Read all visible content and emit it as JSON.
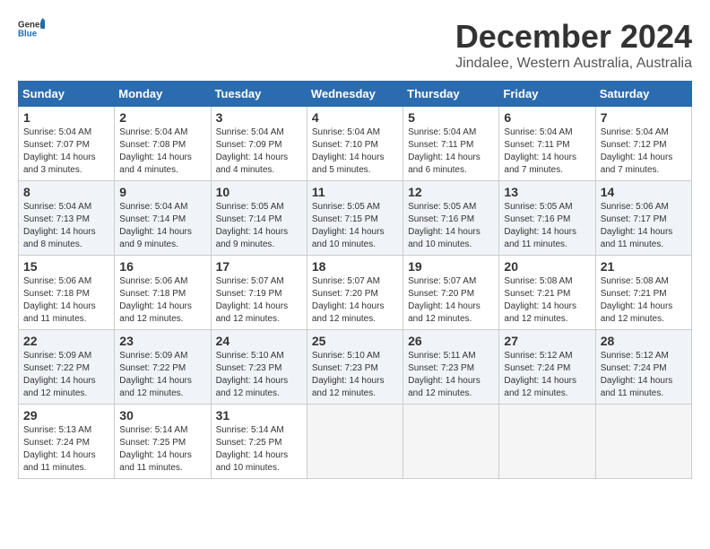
{
  "header": {
    "logo_general": "General",
    "logo_blue": "Blue",
    "title": "December 2024",
    "location": "Jindalee, Western Australia, Australia"
  },
  "calendar": {
    "days_of_week": [
      "Sunday",
      "Monday",
      "Tuesday",
      "Wednesday",
      "Thursday",
      "Friday",
      "Saturday"
    ],
    "weeks": [
      [
        {
          "day": "1",
          "info": "Sunrise: 5:04 AM\nSunset: 7:07 PM\nDaylight: 14 hours\nand 3 minutes."
        },
        {
          "day": "2",
          "info": "Sunrise: 5:04 AM\nSunset: 7:08 PM\nDaylight: 14 hours\nand 4 minutes."
        },
        {
          "day": "3",
          "info": "Sunrise: 5:04 AM\nSunset: 7:09 PM\nDaylight: 14 hours\nand 4 minutes."
        },
        {
          "day": "4",
          "info": "Sunrise: 5:04 AM\nSunset: 7:10 PM\nDaylight: 14 hours\nand 5 minutes."
        },
        {
          "day": "5",
          "info": "Sunrise: 5:04 AM\nSunset: 7:11 PM\nDaylight: 14 hours\nand 6 minutes."
        },
        {
          "day": "6",
          "info": "Sunrise: 5:04 AM\nSunset: 7:11 PM\nDaylight: 14 hours\nand 7 minutes."
        },
        {
          "day": "7",
          "info": "Sunrise: 5:04 AM\nSunset: 7:12 PM\nDaylight: 14 hours\nand 7 minutes."
        }
      ],
      [
        {
          "day": "8",
          "info": "Sunrise: 5:04 AM\nSunset: 7:13 PM\nDaylight: 14 hours\nand 8 minutes."
        },
        {
          "day": "9",
          "info": "Sunrise: 5:04 AM\nSunset: 7:14 PM\nDaylight: 14 hours\nand 9 minutes."
        },
        {
          "day": "10",
          "info": "Sunrise: 5:05 AM\nSunset: 7:14 PM\nDaylight: 14 hours\nand 9 minutes."
        },
        {
          "day": "11",
          "info": "Sunrise: 5:05 AM\nSunset: 7:15 PM\nDaylight: 14 hours\nand 10 minutes."
        },
        {
          "day": "12",
          "info": "Sunrise: 5:05 AM\nSunset: 7:16 PM\nDaylight: 14 hours\nand 10 minutes."
        },
        {
          "day": "13",
          "info": "Sunrise: 5:05 AM\nSunset: 7:16 PM\nDaylight: 14 hours\nand 11 minutes."
        },
        {
          "day": "14",
          "info": "Sunrise: 5:06 AM\nSunset: 7:17 PM\nDaylight: 14 hours\nand 11 minutes."
        }
      ],
      [
        {
          "day": "15",
          "info": "Sunrise: 5:06 AM\nSunset: 7:18 PM\nDaylight: 14 hours\nand 11 minutes."
        },
        {
          "day": "16",
          "info": "Sunrise: 5:06 AM\nSunset: 7:18 PM\nDaylight: 14 hours\nand 12 minutes."
        },
        {
          "day": "17",
          "info": "Sunrise: 5:07 AM\nSunset: 7:19 PM\nDaylight: 14 hours\nand 12 minutes."
        },
        {
          "day": "18",
          "info": "Sunrise: 5:07 AM\nSunset: 7:20 PM\nDaylight: 14 hours\nand 12 minutes."
        },
        {
          "day": "19",
          "info": "Sunrise: 5:07 AM\nSunset: 7:20 PM\nDaylight: 14 hours\nand 12 minutes."
        },
        {
          "day": "20",
          "info": "Sunrise: 5:08 AM\nSunset: 7:21 PM\nDaylight: 14 hours\nand 12 minutes."
        },
        {
          "day": "21",
          "info": "Sunrise: 5:08 AM\nSunset: 7:21 PM\nDaylight: 14 hours\nand 12 minutes."
        }
      ],
      [
        {
          "day": "22",
          "info": "Sunrise: 5:09 AM\nSunset: 7:22 PM\nDaylight: 14 hours\nand 12 minutes."
        },
        {
          "day": "23",
          "info": "Sunrise: 5:09 AM\nSunset: 7:22 PM\nDaylight: 14 hours\nand 12 minutes."
        },
        {
          "day": "24",
          "info": "Sunrise: 5:10 AM\nSunset: 7:23 PM\nDaylight: 14 hours\nand 12 minutes."
        },
        {
          "day": "25",
          "info": "Sunrise: 5:10 AM\nSunset: 7:23 PM\nDaylight: 14 hours\nand 12 minutes."
        },
        {
          "day": "26",
          "info": "Sunrise: 5:11 AM\nSunset: 7:23 PM\nDaylight: 14 hours\nand 12 minutes."
        },
        {
          "day": "27",
          "info": "Sunrise: 5:12 AM\nSunset: 7:24 PM\nDaylight: 14 hours\nand 12 minutes."
        },
        {
          "day": "28",
          "info": "Sunrise: 5:12 AM\nSunset: 7:24 PM\nDaylight: 14 hours\nand 11 minutes."
        }
      ],
      [
        {
          "day": "29",
          "info": "Sunrise: 5:13 AM\nSunset: 7:24 PM\nDaylight: 14 hours\nand 11 minutes."
        },
        {
          "day": "30",
          "info": "Sunrise: 5:14 AM\nSunset: 7:25 PM\nDaylight: 14 hours\nand 11 minutes."
        },
        {
          "day": "31",
          "info": "Sunrise: 5:14 AM\nSunset: 7:25 PM\nDaylight: 14 hours\nand 10 minutes."
        },
        {
          "day": "",
          "info": ""
        },
        {
          "day": "",
          "info": ""
        },
        {
          "day": "",
          "info": ""
        },
        {
          "day": "",
          "info": ""
        }
      ]
    ]
  }
}
